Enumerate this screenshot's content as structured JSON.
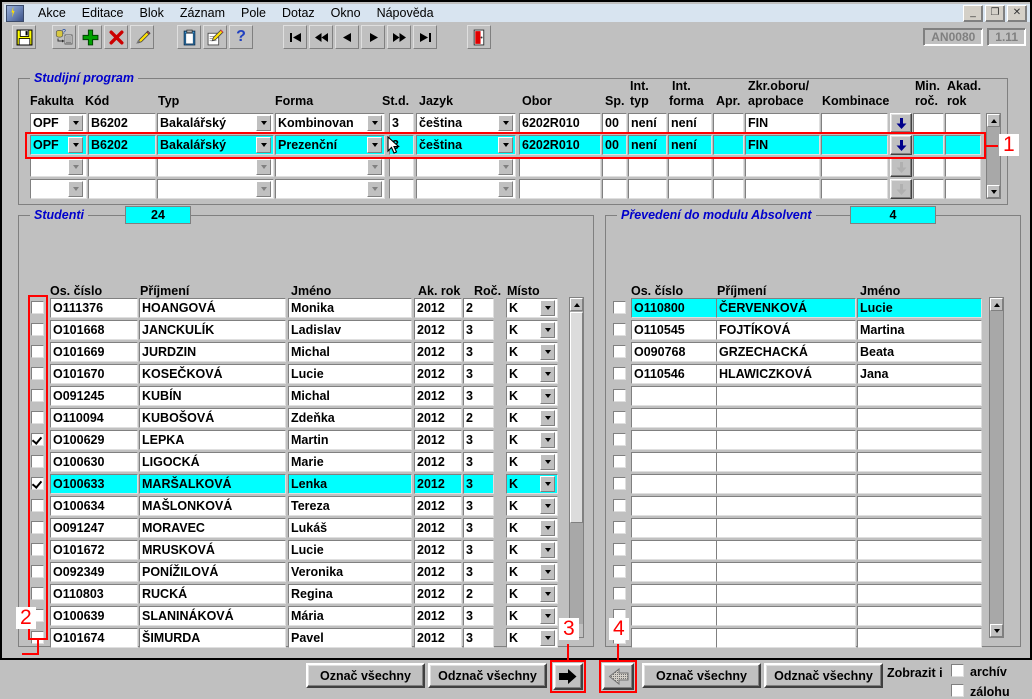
{
  "window": {
    "menu_items": [
      "Akce",
      "Editace",
      "Blok",
      "Záznam",
      "Pole",
      "Dotaz",
      "Okno",
      "Nápověda"
    ],
    "minimize": "_",
    "restore": "❐",
    "close": "✕",
    "form_code": "AN0080",
    "version": "1.11"
  },
  "toolbar": {
    "icons": [
      "save-icon",
      "query-list-icon",
      "add-record-icon",
      "delete-record-icon",
      "edit-icon",
      "clipboard-icon",
      "note-edit-icon",
      "help-icon",
      "first-record-icon",
      "prev-block-icon",
      "prev-record-icon",
      "next-record-icon",
      "next-block-icon",
      "last-record-icon",
      "exit-icon"
    ]
  },
  "program_group": {
    "title": "Studijní program",
    "columns": [
      {
        "label": "Fakulta"
      },
      {
        "label": "Kód"
      },
      {
        "label": "Typ"
      },
      {
        "label": "Forma"
      },
      {
        "label": "St.d."
      },
      {
        "label": "Jazyk"
      },
      {
        "label": "Obor"
      },
      {
        "label": "Sp."
      },
      {
        "label": "Int.\ntyp"
      },
      {
        "label": "Int.\nforma"
      },
      {
        "label": "Apr."
      },
      {
        "label": "Zkr.oboru/\naprobace"
      },
      {
        "label": "Kombinace"
      },
      {
        "label": ""
      },
      {
        "label": "Min.\nroč."
      },
      {
        "label": "Akad.\nrok"
      }
    ],
    "header_lines": {
      "fakulta": "Fakulta",
      "kod": "Kód",
      "typ": "Typ",
      "forma": "Forma",
      "std": "St.d.",
      "jazyk": "Jazyk",
      "obor": "Obor",
      "sp": "Sp.",
      "int_typ_1": "Int.",
      "int_typ_2": "typ",
      "int_forma_1": "Int.",
      "int_forma_2": "forma",
      "apr": "Apr.",
      "zkr_1": "Zkr.oboru/",
      "zkr_2": "aprobace",
      "kombinace": "Kombinace",
      "min_1": "Min.",
      "min_2": "roč.",
      "akad_1": "Akad.",
      "akad_2": "rok"
    },
    "rows": [
      {
        "selected": false,
        "fakulta": "OPF",
        "kod": "B6202",
        "typ": "Bakalářský",
        "forma": "Kombinovan",
        "std": "3",
        "jazyk": "čeština",
        "obor": "6202R010",
        "sp": "00",
        "int_typ": "není",
        "int_forma": "není",
        "apr": "",
        "zkr": "FIN",
        "kombinace": "",
        "min_roc": "",
        "akad_rok": ""
      },
      {
        "selected": true,
        "fakulta": "OPF",
        "kod": "B6202",
        "typ": "Bakalářský",
        "forma": "Prezenční",
        "std": "3",
        "jazyk": "čeština",
        "obor": "6202R010",
        "sp": "00",
        "int_typ": "není",
        "int_forma": "není",
        "apr": "",
        "zkr": "FIN",
        "kombinace": "",
        "min_roc": "",
        "akad_rok": ""
      },
      {
        "selected": false,
        "fakulta": "",
        "kod": "",
        "typ": "",
        "forma": "",
        "std": "",
        "jazyk": "",
        "obor": "",
        "sp": "",
        "int_typ": "",
        "int_forma": "",
        "apr": "",
        "zkr": "",
        "kombinace": "",
        "min_roc": "",
        "akad_rok": ""
      },
      {
        "selected": false,
        "fakulta": "",
        "kod": "",
        "typ": "",
        "forma": "",
        "std": "",
        "jazyk": "",
        "obor": "",
        "sp": "",
        "int_typ": "",
        "int_forma": "",
        "apr": "",
        "zkr": "",
        "kombinace": "",
        "min_roc": "",
        "akad_rok": ""
      }
    ]
  },
  "students_group": {
    "title": "Studenti",
    "count": "24",
    "columns": [
      "Os. číslo",
      "Příjmení",
      "Jméno",
      "Ak. rok",
      "Roč.",
      "Místo"
    ],
    "rows": [
      {
        "checked": false,
        "selected": false,
        "os_cislo": "O111376",
        "prijmeni": "HOANGOVÁ",
        "jmeno": "Monika",
        "ak_rok": "2012",
        "roc": "2",
        "misto": "K"
      },
      {
        "checked": false,
        "selected": false,
        "os_cislo": "O101668",
        "prijmeni": "JANCKULÍK",
        "jmeno": "Ladislav",
        "ak_rok": "2012",
        "roc": "3",
        "misto": "K"
      },
      {
        "checked": false,
        "selected": false,
        "os_cislo": "O101669",
        "prijmeni": "JURDZIN",
        "jmeno": "Michal",
        "ak_rok": "2012",
        "roc": "3",
        "misto": "K"
      },
      {
        "checked": false,
        "selected": false,
        "os_cislo": "O101670",
        "prijmeni": "KOSEČKOVÁ",
        "jmeno": "Lucie",
        "ak_rok": "2012",
        "roc": "3",
        "misto": "K"
      },
      {
        "checked": false,
        "selected": false,
        "os_cislo": "O091245",
        "prijmeni": "KUBÍN",
        "jmeno": "Michal",
        "ak_rok": "2012",
        "roc": "3",
        "misto": "K"
      },
      {
        "checked": false,
        "selected": false,
        "os_cislo": "O110094",
        "prijmeni": "KUBOŠOVÁ",
        "jmeno": "Zdeňka",
        "ak_rok": "2012",
        "roc": "2",
        "misto": "K"
      },
      {
        "checked": true,
        "selected": false,
        "os_cislo": "O100629",
        "prijmeni": "LEPKA",
        "jmeno": "Martin",
        "ak_rok": "2012",
        "roc": "3",
        "misto": "K"
      },
      {
        "checked": false,
        "selected": false,
        "os_cislo": "O100630",
        "prijmeni": "LIGOCKÁ",
        "jmeno": "Marie",
        "ak_rok": "2012",
        "roc": "3",
        "misto": "K"
      },
      {
        "checked": true,
        "selected": true,
        "os_cislo": "O100633",
        "prijmeni": "MARŠALKOVÁ",
        "jmeno": "Lenka",
        "ak_rok": "2012",
        "roc": "3",
        "misto": "K"
      },
      {
        "checked": false,
        "selected": false,
        "os_cislo": "O100634",
        "prijmeni": "MAŠLONKOVÁ",
        "jmeno": "Tereza",
        "ak_rok": "2012",
        "roc": "3",
        "misto": "K"
      },
      {
        "checked": false,
        "selected": false,
        "os_cislo": "O091247",
        "prijmeni": "MORAVEC",
        "jmeno": "Lukáš",
        "ak_rok": "2012",
        "roc": "3",
        "misto": "K"
      },
      {
        "checked": false,
        "selected": false,
        "os_cislo": "O101672",
        "prijmeni": "MRUSKOVÁ",
        "jmeno": "Lucie",
        "ak_rok": "2012",
        "roc": "3",
        "misto": "K"
      },
      {
        "checked": false,
        "selected": false,
        "os_cislo": "O092349",
        "prijmeni": "PONÍŽILOVÁ",
        "jmeno": "Veronika",
        "ak_rok": "2012",
        "roc": "3",
        "misto": "K"
      },
      {
        "checked": false,
        "selected": false,
        "os_cislo": "O110803",
        "prijmeni": "RUCKÁ",
        "jmeno": "Regina",
        "ak_rok": "2012",
        "roc": "2",
        "misto": "K"
      },
      {
        "checked": false,
        "selected": false,
        "os_cislo": "O100639",
        "prijmeni": "SLANINÁKOVÁ",
        "jmeno": "Mária",
        "ak_rok": "2012",
        "roc": "3",
        "misto": "K"
      },
      {
        "checked": false,
        "selected": false,
        "os_cislo": "O101674",
        "prijmeni": "ŠIMURDA",
        "jmeno": "Pavel",
        "ak_rok": "2012",
        "roc": "3",
        "misto": "K"
      }
    ],
    "buttons": {
      "select_all": "Označ všechny",
      "deselect_all": "Odznač všechny",
      "transfer_right": "right-arrow-icon"
    }
  },
  "absolvent_group": {
    "title": "Převedení do modulu Absolvent",
    "count": "4",
    "columns": [
      "Os. číslo",
      "Příjmení",
      "Jméno"
    ],
    "rows": [
      {
        "checked": false,
        "selected": true,
        "os_cislo": "O110800",
        "prijmeni": "ČERVENKOVÁ",
        "jmeno": "Lucie"
      },
      {
        "checked": false,
        "selected": false,
        "os_cislo": "O110545",
        "prijmeni": "FOJTÍKOVÁ",
        "jmeno": "Martina"
      },
      {
        "checked": false,
        "selected": false,
        "os_cislo": "O090768",
        "prijmeni": "GRZECHACKÁ",
        "jmeno": "Beata"
      },
      {
        "checked": false,
        "selected": false,
        "os_cislo": "O110546",
        "prijmeni": "HLAWICZKOVÁ",
        "jmeno": "Jana"
      },
      {
        "checked": false,
        "selected": false,
        "os_cislo": "",
        "prijmeni": "",
        "jmeno": ""
      },
      {
        "checked": false,
        "selected": false,
        "os_cislo": "",
        "prijmeni": "",
        "jmeno": ""
      },
      {
        "checked": false,
        "selected": false,
        "os_cislo": "",
        "prijmeni": "",
        "jmeno": ""
      },
      {
        "checked": false,
        "selected": false,
        "os_cislo": "",
        "prijmeni": "",
        "jmeno": ""
      },
      {
        "checked": false,
        "selected": false,
        "os_cislo": "",
        "prijmeni": "",
        "jmeno": ""
      },
      {
        "checked": false,
        "selected": false,
        "os_cislo": "",
        "prijmeni": "",
        "jmeno": ""
      },
      {
        "checked": false,
        "selected": false,
        "os_cislo": "",
        "prijmeni": "",
        "jmeno": ""
      },
      {
        "checked": false,
        "selected": false,
        "os_cislo": "",
        "prijmeni": "",
        "jmeno": ""
      },
      {
        "checked": false,
        "selected": false,
        "os_cislo": "",
        "prijmeni": "",
        "jmeno": ""
      },
      {
        "checked": false,
        "selected": false,
        "os_cislo": "",
        "prijmeni": "",
        "jmeno": ""
      },
      {
        "checked": false,
        "selected": false,
        "os_cislo": "",
        "prijmeni": "",
        "jmeno": ""
      },
      {
        "checked": false,
        "selected": false,
        "os_cislo": "",
        "prijmeni": "",
        "jmeno": ""
      }
    ],
    "buttons": {
      "transfer_left": "left-arrow-icon",
      "select_all": "Označ všechny",
      "deselect_all": "Odznač všechny"
    },
    "show_also_label": "Zobrazit i",
    "archive_label": "archív",
    "backup_label": "zálohu",
    "archive_checked": false,
    "backup_checked": false
  },
  "annotations": [
    {
      "id": "1",
      "label": "1"
    },
    {
      "id": "2",
      "label": "2"
    },
    {
      "id": "3",
      "label": "3"
    },
    {
      "id": "4",
      "label": "4"
    }
  ],
  "colors": {
    "highlight": "#00ffff",
    "annotation": "#ff0000",
    "group_label": "#0000cc",
    "face": "#c0c0c0"
  }
}
